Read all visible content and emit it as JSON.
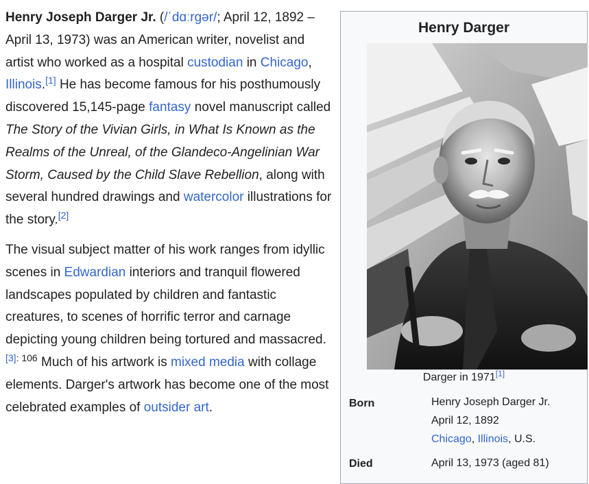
{
  "article": {
    "p1": {
      "name": "Henry Joseph Darger Jr.",
      "pron_open": " (",
      "ipa": "/ˈdɑːrɡər/",
      "t1": "; April 12, 1892 – April 13, 1973) was an American writer, novelist and artist who worked as a hospital ",
      "link_custodian": "custodian",
      "t2": " in ",
      "link_chicago": "Chicago",
      "t3": ", ",
      "link_illinois": "Illinois",
      "t4": ".",
      "ref1": "[1]",
      "t5": " He has become famous for his posthumously discovered 15,145-page ",
      "link_fantasy": "fantasy",
      "t6": " novel manuscript called ",
      "title_italic": "The Story of the Vivian Girls, in What Is Known as the Realms of the Unreal, of the Glandeco-Angelinian War Storm, Caused by the Child Slave Rebellion",
      "t7": ", along with several hundred drawings and ",
      "link_watercolor": "watercolor",
      "t8": " illustrations for the story.",
      "ref2": "[2]"
    },
    "p2": {
      "t1": "The visual subject matter of his work ranges from idyllic scenes in ",
      "link_edwardian": "Edwardian",
      "t2": " interiors and tranquil flowered landscapes populated by children and fantastic creatures, to scenes of horrific terror and carnage depicting young children being tortured and massacred.",
      "ref3": "[3]",
      "page": ": 106",
      "t3": " Much of his artwork is ",
      "link_mixed_media": "mixed media",
      "t4": " with collage elements. Darger's artwork has become one of the most celebrated examples of ",
      "link_outsider_art": "outsider art",
      "t5": "."
    }
  },
  "infobox": {
    "title": "Henry Darger",
    "photo_description": "Black-and-white photograph of an elderly man with a white mustache, seated and leaning forward",
    "caption": "Darger in 1971",
    "caption_ref": "[1]",
    "born_label": "Born",
    "born_name": "Henry Joseph Darger Jr.",
    "born_date": "April 12, 1892",
    "born_place_chicago": "Chicago",
    "born_place_sep": ", ",
    "born_place_illinois": "Illinois",
    "born_place_country": ", U.S.",
    "died_label": "Died",
    "died_date": "April 13, 1973 (aged 81)"
  },
  "colors": {
    "link": "#3366cc",
    "text": "#202122",
    "infobox_bg": "#f8f9fa",
    "infobox_border": "#a2a9b1"
  }
}
